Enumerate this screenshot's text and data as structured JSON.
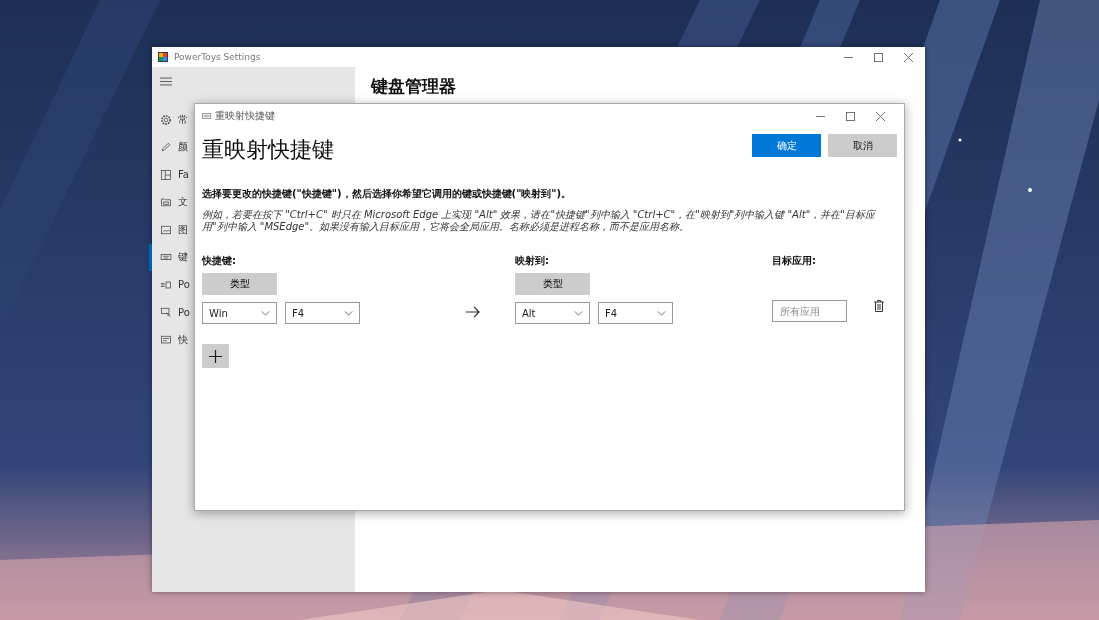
{
  "window": {
    "title": "PowerToys Settings"
  },
  "sidebar": {
    "items": [
      {
        "label": "常",
        "selected": false
      },
      {
        "label": "颜",
        "selected": false
      },
      {
        "label": "Fa",
        "selected": false
      },
      {
        "label": "文",
        "selected": false
      },
      {
        "label": "图",
        "selected": false
      },
      {
        "label": "键",
        "selected": true
      },
      {
        "label": "Po",
        "selected": false
      },
      {
        "label": "Po",
        "selected": false
      },
      {
        "label": "快",
        "selected": false
      }
    ]
  },
  "page_title": "键盘管理器",
  "dialog": {
    "title": "重映射快捷键",
    "heading": "重映射快捷键",
    "buttons": [
      {
        "label": "确定",
        "kind": "primary"
      },
      {
        "label": "取消",
        "kind": "secondary"
      }
    ],
    "instruction": "选择要更改的快捷键(\"快捷键\")，然后选择你希望它调用的键或快捷键(\"映射到\")。",
    "example": "例如，若要在按下 \"Ctrl+C\" 时只在 Microsoft Edge 上实现 \"Alt\" 效果，请在\"快捷键\"列中输入 \"Ctrl+C\"，在\"映射到\"列中输入键 \"Alt\"，并在\"目标应用\"列中输入 \"MSEdge\"。如果没有输入目标应用，它将会全局应用。名称必须是进程名称，而不是应用名称。",
    "columns": {
      "shortcut": "快捷键:",
      "mapped_to": "映射到:",
      "target_app": "目标应用:"
    },
    "rows": [
      {
        "shortcut": {
          "type_button": "类型",
          "keys": [
            "Win",
            "F4"
          ]
        },
        "mapped": {
          "type_button": "类型",
          "keys": [
            "Alt",
            "F4"
          ]
        },
        "target_placeholder": "所有应用"
      }
    ]
  }
}
